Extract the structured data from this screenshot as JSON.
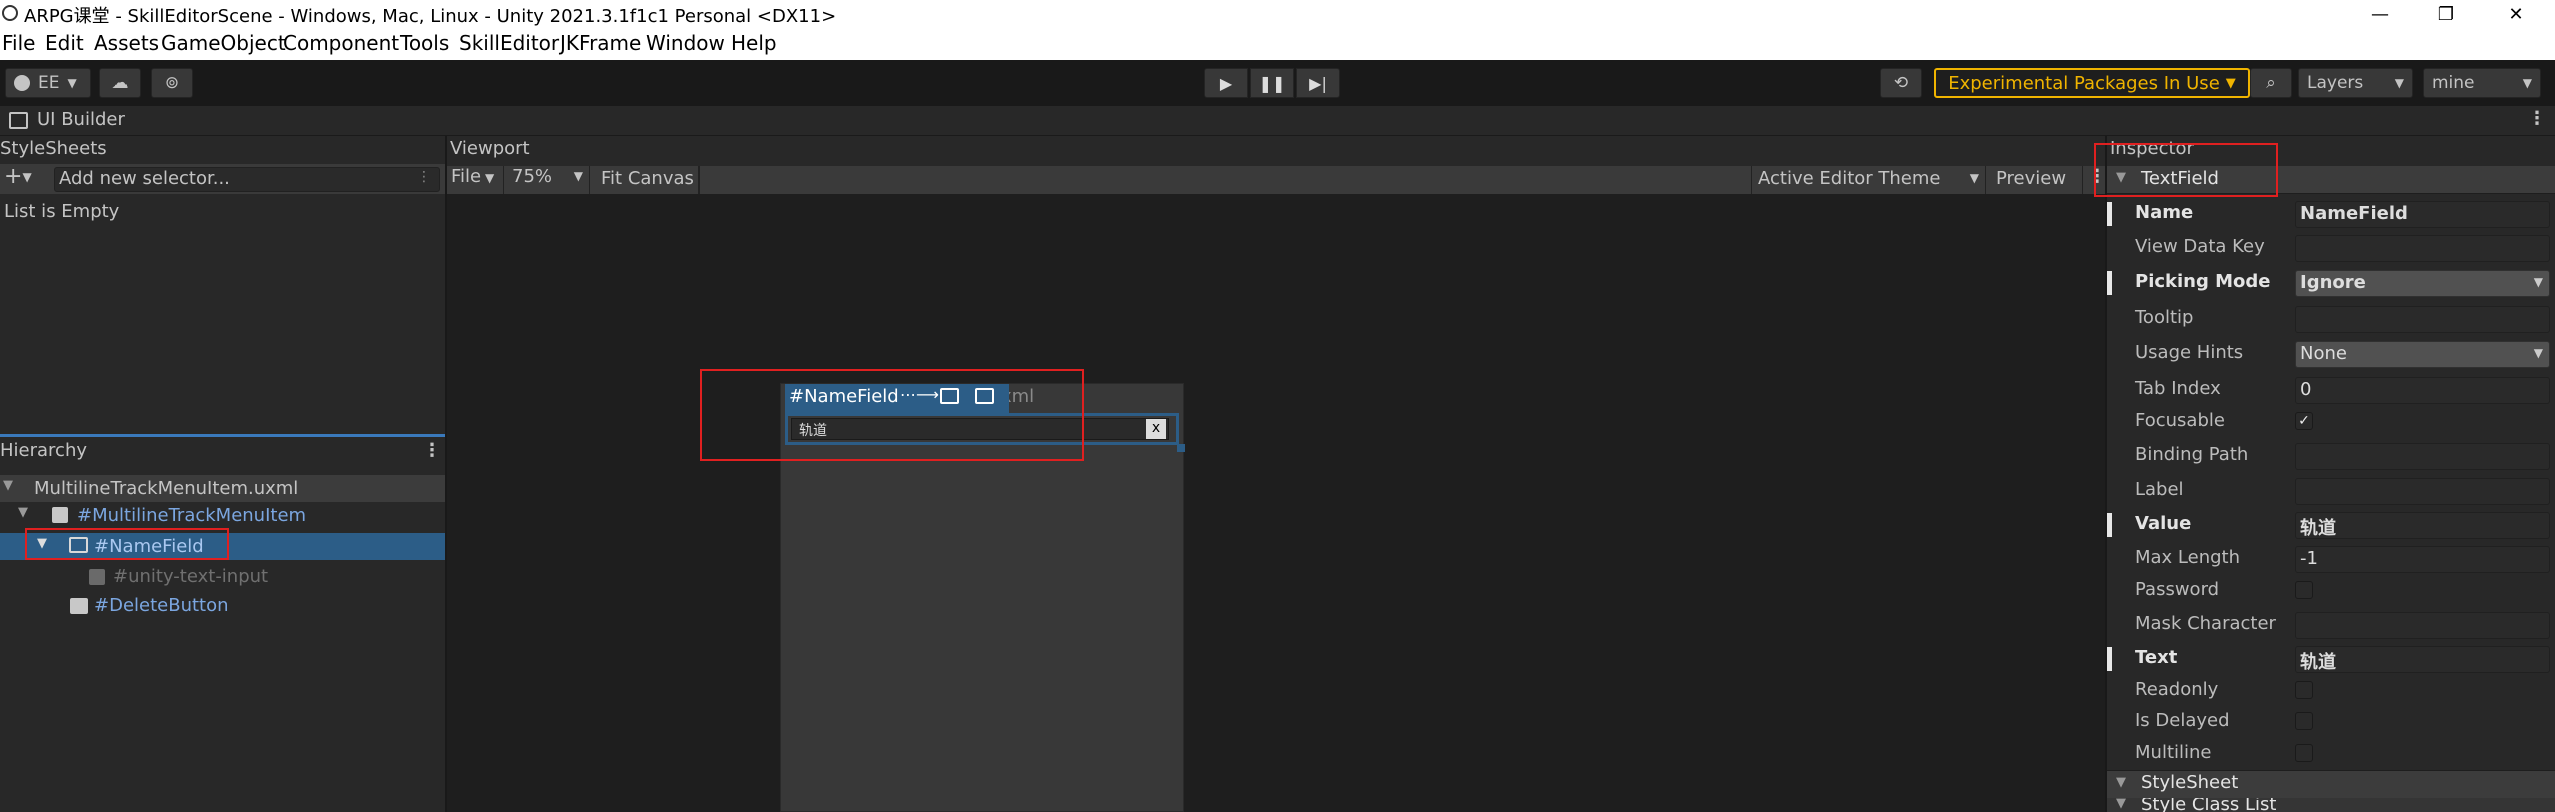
{
  "window": {
    "title": "ARPG课堂 - SkillEditorScene - Windows, Mac, Linux - Unity 2021.3.1f1c1 Personal <DX11>"
  },
  "menu": [
    "File",
    "Edit",
    "Assets",
    "GameObject",
    "Component",
    "Tools",
    "SkillEditor",
    "JKFrame",
    "Window",
    "Help"
  ],
  "toolbar": {
    "account": "EE",
    "experimental": "Experimental Packages In Use",
    "layers": "Layers",
    "layout": "mine"
  },
  "ui_builder": {
    "tab": "UI Builder"
  },
  "stylesheets": {
    "title": "StyleSheets",
    "add_placeholder": "Add new selector...",
    "empty": "List is Empty"
  },
  "hierarchy": {
    "title": "Hierarchy",
    "items": [
      "MultilineTrackMenuItem.uxml",
      "#MultilineTrackMenuItem",
      "#NameField",
      "#unity-text-input",
      "#DeleteButton"
    ]
  },
  "viewport": {
    "title": "Viewport",
    "file": "File",
    "zoom": "75%",
    "fit": "Fit Canvas",
    "theme": "Active Editor Theme",
    "preview": "Preview",
    "selected_label": "#NameField",
    "bg_text": "xml",
    "field_value": "轨道",
    "clear": "x"
  },
  "inspector": {
    "title": "Inspector",
    "section": "TextField",
    "fields": [
      {
        "label": "Name",
        "value": "NameField",
        "kind": "text",
        "bold": true
      },
      {
        "label": "View Data Key",
        "value": "",
        "kind": "text",
        "bold": false
      },
      {
        "label": "Picking Mode",
        "value": "Ignore",
        "kind": "dropdown",
        "bold": true
      },
      {
        "label": "Tooltip",
        "value": "",
        "kind": "text",
        "bold": false
      },
      {
        "label": "Usage Hints",
        "value": "None",
        "kind": "dropdown",
        "bold": false
      },
      {
        "label": "Tab Index",
        "value": "0",
        "kind": "text",
        "bold": false
      },
      {
        "label": "Focusable",
        "value": "✓",
        "kind": "check",
        "bold": false
      },
      {
        "label": "Binding Path",
        "value": "",
        "kind": "text",
        "bold": false
      },
      {
        "label": "Label",
        "value": "",
        "kind": "text",
        "bold": false
      },
      {
        "label": "Value",
        "value": "轨道",
        "kind": "text",
        "bold": true
      },
      {
        "label": "Max Length",
        "value": "-1",
        "kind": "text",
        "bold": false
      },
      {
        "label": "Password",
        "value": "",
        "kind": "check",
        "bold": false
      },
      {
        "label": "Mask Character",
        "value": "",
        "kind": "text",
        "bold": false
      },
      {
        "label": "Text",
        "value": "轨道",
        "kind": "text",
        "bold": true
      },
      {
        "label": "Readonly",
        "value": "",
        "kind": "check",
        "bold": false
      },
      {
        "label": "Is Delayed",
        "value": "",
        "kind": "check",
        "bold": false
      },
      {
        "label": "Multiline",
        "value": "",
        "kind": "check",
        "bold": false
      }
    ],
    "section2": "StyleSheet",
    "section3": "Style Class List"
  },
  "colors": {
    "accent": "#2c5d87",
    "highlight": "#e02020",
    "experimental": "#f0b400",
    "link": "#7ba6e0"
  }
}
